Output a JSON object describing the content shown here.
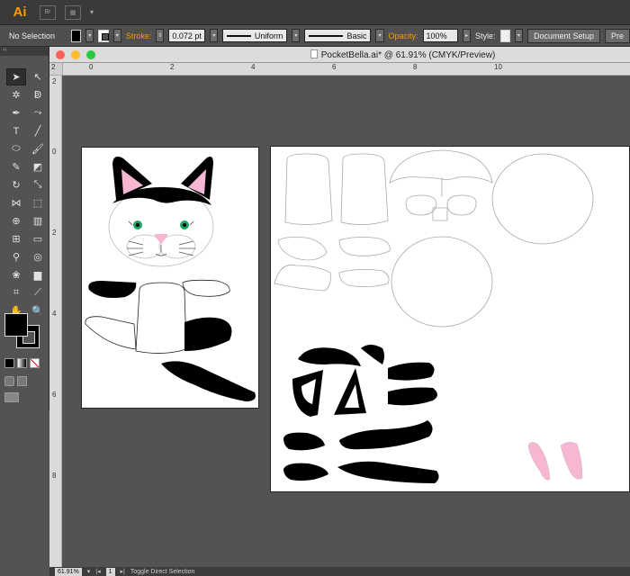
{
  "app": {
    "logo": "Ai",
    "bridge_label": "Br",
    "arrange_icon": "arrange-documents-icon"
  },
  "control_bar": {
    "selection": "No Selection",
    "stroke_label": "Stroke:",
    "stroke_weight": "0.072 pt",
    "profile": "Uniform",
    "brush": "Basic",
    "opacity_label": "Opacity:",
    "opacity": "100%",
    "style_label": "Style:",
    "doc_setup": "Document Setup",
    "prefs": "Pre"
  },
  "document": {
    "title": "PocketBella.ai* @ 61.91% (CMYK/Preview)"
  },
  "rulers": {
    "top": [
      "2",
      "0",
      "2",
      "4",
      "6",
      "8",
      "10"
    ],
    "left": [
      "2",
      "0",
      "2",
      "4",
      "6",
      "8"
    ]
  },
  "status": {
    "zoom": "61.91%",
    "artboard": "1",
    "tool": "Toggle Direct Selection"
  },
  "tools": [
    "selection-tool",
    "direct-selection-tool",
    "magic-wand-tool",
    "lasso-tool",
    "pen-tool",
    "curvature-tool",
    "type-tool",
    "line-tool",
    "ellipse-tool",
    "paintbrush-tool",
    "pencil-tool",
    "eraser-tool",
    "rotate-tool",
    "scale-tool",
    "width-tool",
    "free-transform-tool",
    "shape-builder-tool",
    "perspective-grid-tool",
    "mesh-tool",
    "gradient-tool",
    "eyedropper-tool",
    "blend-tool",
    "symbol-sprayer-tool",
    "column-graph-tool",
    "artboard-tool",
    "slice-tool",
    "hand-tool",
    "zoom-tool"
  ],
  "colors": {
    "fill": "#000000",
    "stroke": "#000000",
    "pink": "#f7b6d2",
    "green": "#1fa463"
  }
}
